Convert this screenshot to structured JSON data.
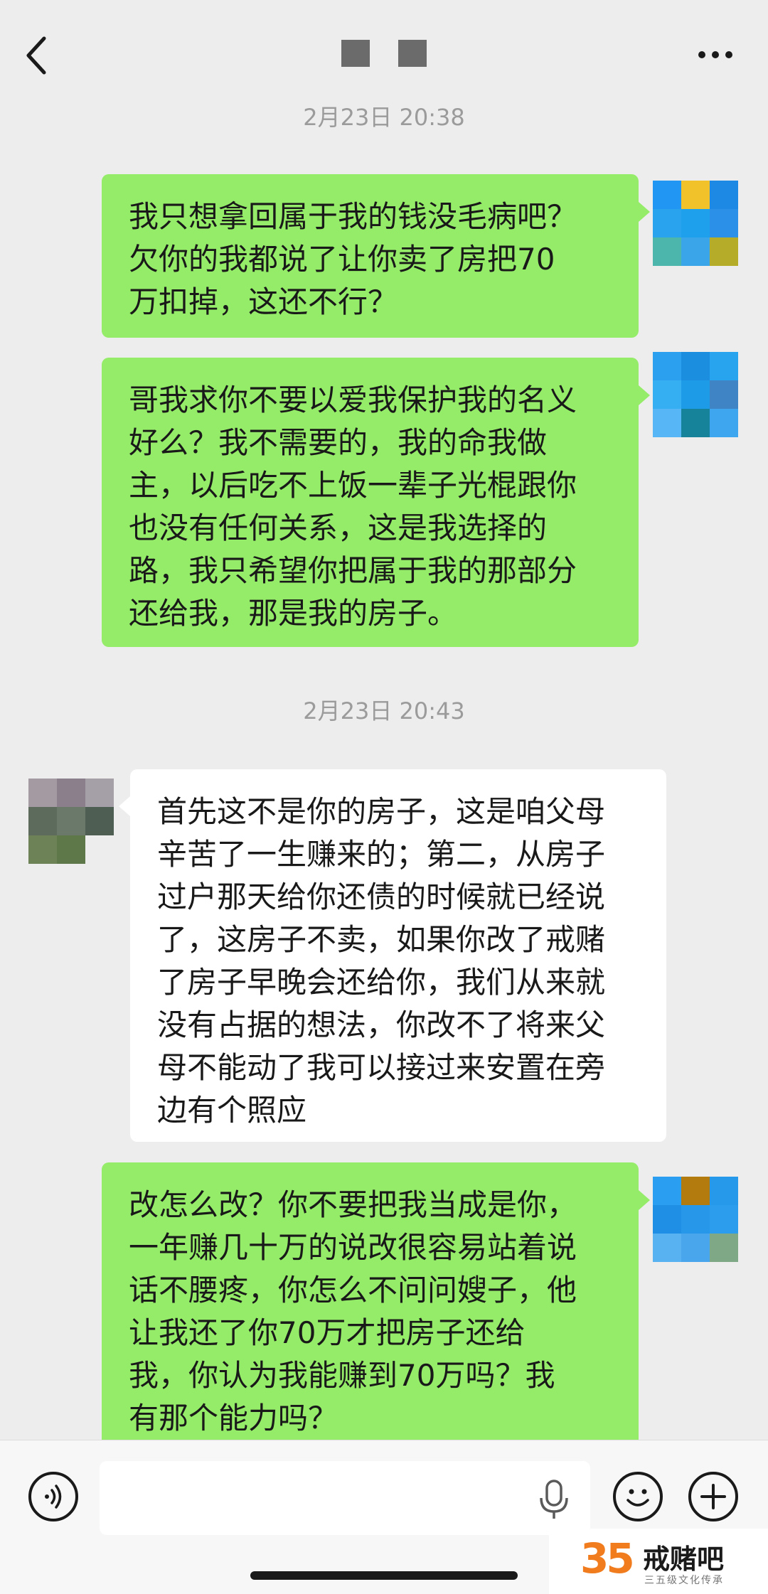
{
  "header": {
    "back_icon": "chevron-left-icon",
    "title_redacted": "■ ■",
    "more_icon": "more-dots-icon"
  },
  "messages": [
    {
      "type": "timestamp",
      "text": "2月23日 20:38"
    },
    {
      "type": "bubble",
      "side": "right",
      "text": "我只想拿回属于我的钱没毛病吧？\n欠你的我都说了让你卖了房把70\n万扣掉，这还不行？"
    },
    {
      "type": "bubble",
      "side": "right",
      "text": "哥我求你不要以爱我保护我的名义\n好么？我不需要的，我的命我做\n主，以后吃不上饭一辈子光棍跟你\n也没有任何关系，这是我选择的\n路，我只希望你把属于我的那部分\n还给我，那是我的房子。"
    },
    {
      "type": "timestamp",
      "text": "2月23日 20:43"
    },
    {
      "type": "bubble",
      "side": "left",
      "text": "首先这不是你的房子，这是咱父母\n辛苦了一生赚来的；第二，从房子\n过户那天给你还债的时候就已经说\n了，这房子不卖，如果你改了戒赌\n了房子早晚会还给你，我们从来就\n没有占据的想法，你改不了将来父\n母不能动了我可以接过来安置在旁\n边有个照应"
    },
    {
      "type": "bubble",
      "side": "right",
      "text": "改怎么改？你不要把我当成是你，\n一年赚几十万的说改很容易站着说\n话不腰疼，你怎么不问问嫂子，他\n让我还了你70万才把房子还给\n我，你认为我能赚到70万吗？我\n有那个能力吗？"
    }
  ],
  "input_bar": {
    "voice_icon": "voice-mode-icon",
    "input_value": "",
    "mic_icon": "microphone-icon",
    "emoji_icon": "emoji-icon",
    "plus_icon": "plus-icon"
  },
  "watermark": {
    "number": "35",
    "title": "戒赌吧",
    "subtitle": "三五级文化传承"
  },
  "colors": {
    "background": "#ededed",
    "my_bubble": "#95ec69",
    "other_bubble": "#ffffff",
    "timestamp": "#9b9b9b",
    "watermark_accent": "#f07c1d"
  }
}
